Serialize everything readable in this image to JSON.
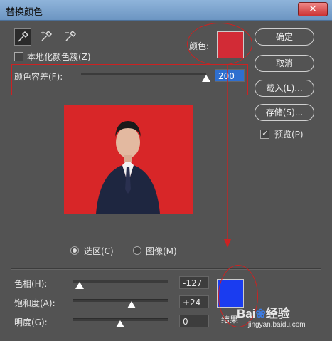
{
  "window": {
    "title": "替换颜色",
    "close_symbol": "✕"
  },
  "tools": [
    {
      "name": "eyedropper-icon",
      "active": true
    },
    {
      "name": "eyedropper-plus-icon",
      "active": false
    },
    {
      "name": "eyedropper-minus-icon",
      "active": false
    }
  ],
  "selection": {
    "localized_clusters_label": "本地化颜色簇(Z)",
    "localized_clusters_checked": false,
    "color_label": "颜色:",
    "color_swatch": "#d22b36",
    "fuzziness_label": "颜色容差(F):",
    "fuzziness_value": "200",
    "fuzziness_fraction": 1.0
  },
  "buttons": {
    "ok": "确定",
    "cancel": "取消",
    "load": "载入(L)...",
    "save": "存储(S)..."
  },
  "preview": {
    "label": "预览(P)",
    "checked": true
  },
  "preview_image": {
    "background_color": "#d82628"
  },
  "view_mode": {
    "selection_label": "选区(C)",
    "image_label": "图像(M)",
    "selected": "selection"
  },
  "replacement": {
    "hue_label": "色相(H):",
    "hue_value": "-127",
    "hue_fraction": 0.075,
    "saturation_label": "饱和度(A):",
    "saturation_value": "+24",
    "saturation_fraction": 0.62,
    "lightness_label": "明度(G):",
    "lightness_value": "0",
    "lightness_fraction": 0.5,
    "result_label": "结果",
    "result_swatch": "#1a3cf0"
  },
  "annotation_color": "#cc2222",
  "watermark": {
    "brand": "Bai",
    "brand_suffix": "经验",
    "site": "jingyan.baidu.com"
  }
}
